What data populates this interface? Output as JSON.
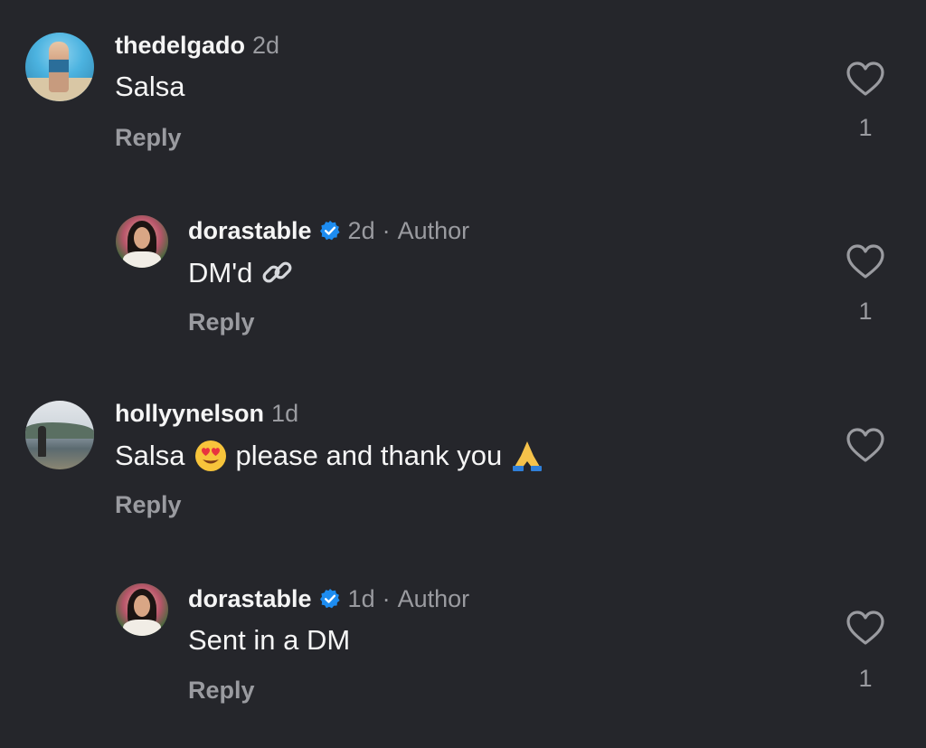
{
  "comments": [
    {
      "username": "thedelgado",
      "time": "2d",
      "text": "Salsa",
      "reply_label": "Reply",
      "likes": "1"
    },
    {
      "username": "dorastable",
      "time": "2d",
      "dot": "·",
      "author_label": "Author",
      "text": "DM'd",
      "emoji": "link-emoji",
      "reply_label": "Reply",
      "likes": "1"
    },
    {
      "username": "hollyynelson",
      "time": "1d",
      "text_part1": "Salsa",
      "emoji1": "heart-eyes-emoji",
      "text_part2": "please and thank you",
      "emoji2": "folded-hands-emoji",
      "reply_label": "Reply"
    },
    {
      "username": "dorastable",
      "time": "1d",
      "dot": "·",
      "author_label": "Author",
      "text": "Sent in a DM",
      "reply_label": "Reply",
      "likes": "1"
    }
  ],
  "colors": {
    "background": "#25262b",
    "text": "#f5f5f5",
    "secondary": "#9a9ba0",
    "verified": "#1d8cf0"
  }
}
